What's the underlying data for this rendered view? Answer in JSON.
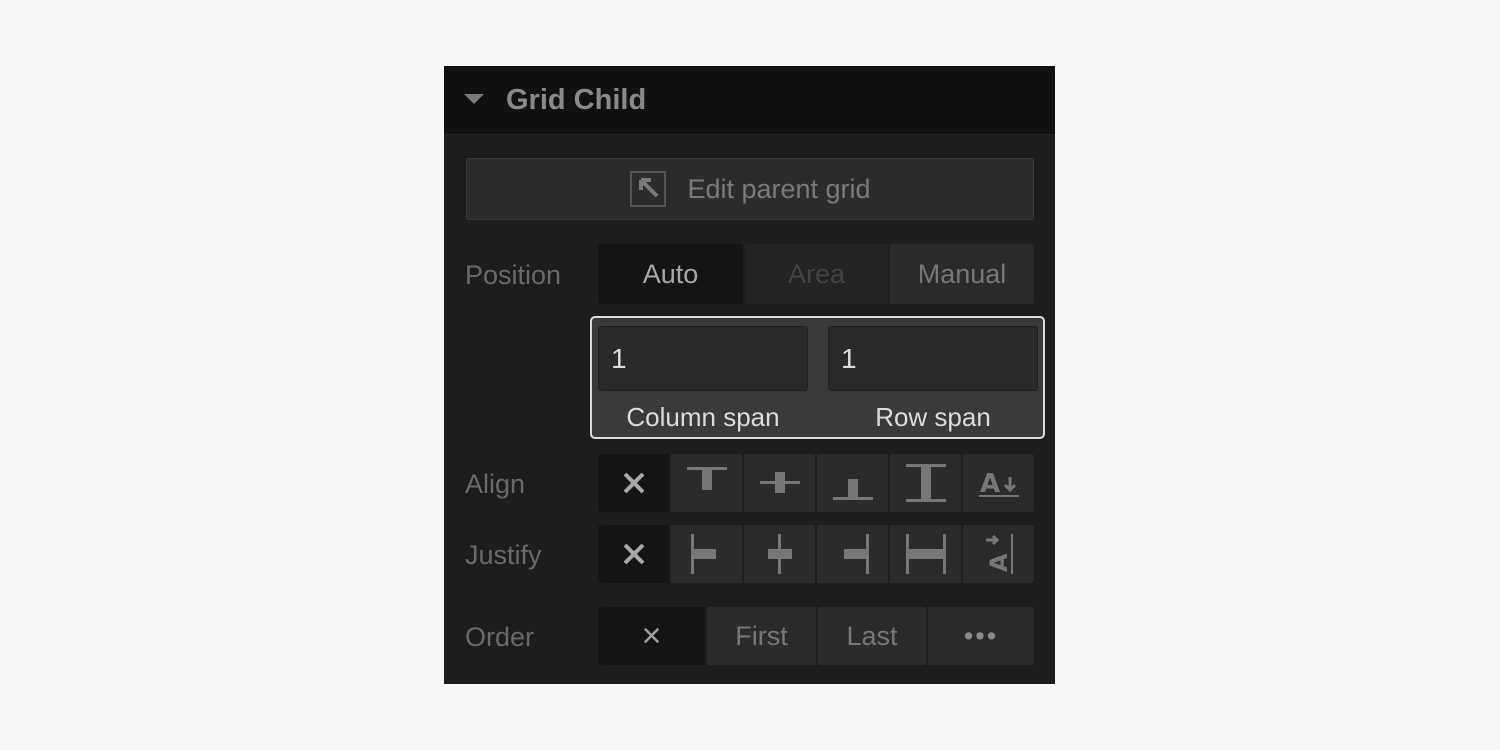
{
  "panel": {
    "title": "Grid Child",
    "edit_parent_label": "Edit parent grid"
  },
  "position": {
    "label": "Position",
    "options": [
      "Auto",
      "Area",
      "Manual"
    ],
    "selected": "Auto"
  },
  "spans": {
    "column_value": "1",
    "row_value": "1",
    "column_label": "Column span",
    "row_label": "Row span"
  },
  "align": {
    "label": "Align",
    "icons": [
      "clear-icon",
      "align-start-icon",
      "align-center-icon",
      "align-end-icon",
      "align-stretch-icon",
      "align-baseline-icon"
    ]
  },
  "justify": {
    "label": "Justify",
    "icons": [
      "clear-icon",
      "justify-start-icon",
      "justify-center-icon",
      "justify-end-icon",
      "justify-stretch-icon",
      "justify-baseline-icon"
    ]
  },
  "order": {
    "label": "Order",
    "options": [
      "×",
      "First",
      "Last",
      "•••"
    ]
  },
  "colors": {
    "page_bg": "#f6f7f8",
    "panel_bg": "#1d1d1d",
    "header_bg": "#111111",
    "highlight_border": "#dcdcdc"
  }
}
